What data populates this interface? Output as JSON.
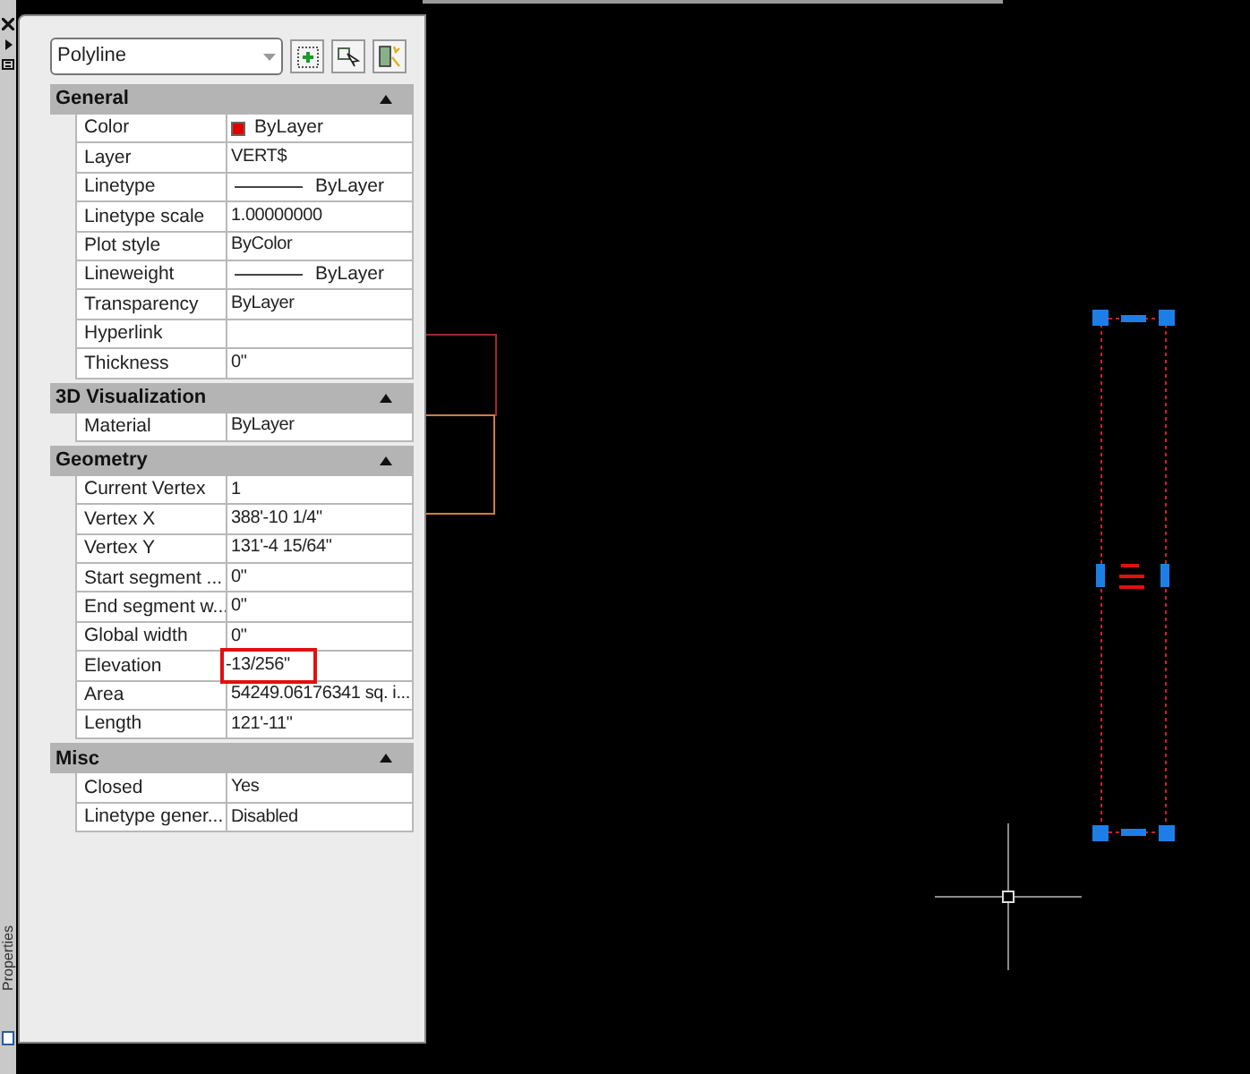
{
  "side_strip": {
    "label": "Properties"
  },
  "selector": {
    "value": "Polyline"
  },
  "sections": [
    {
      "title": "General",
      "expanded": true,
      "rows": [
        {
          "label": "Color",
          "value": "ByLayer",
          "kind": "swatch",
          "color": "#dd0000",
          "highlighted": false
        },
        {
          "label": "Layer",
          "value": "VERT$",
          "kind": "text",
          "highlighted": false
        },
        {
          "label": "Linetype",
          "value": "ByLayer",
          "kind": "line",
          "highlighted": false
        },
        {
          "label": "Linetype scale",
          "value": "1.00000000",
          "kind": "text",
          "highlighted": false
        },
        {
          "label": "Plot style",
          "value": "ByColor",
          "kind": "text",
          "highlighted": false
        },
        {
          "label": "Lineweight",
          "value": "ByLayer",
          "kind": "line",
          "highlighted": false
        },
        {
          "label": "Transparency",
          "value": "ByLayer",
          "kind": "text",
          "highlighted": false
        },
        {
          "label": "Hyperlink",
          "kind": "text",
          "highlighted": false
        },
        {
          "label": "Thickness",
          "value": "0\"",
          "kind": "text",
          "highlighted": false
        }
      ]
    },
    {
      "title": "3D Visualization",
      "expanded": true,
      "rows": [
        {
          "label": "Material",
          "value": "ByLayer",
          "kind": "text",
          "highlighted": false
        }
      ]
    },
    {
      "title": "Geometry",
      "expanded": true,
      "rows": [
        {
          "label": "Current Vertex",
          "value": "1",
          "kind": "text",
          "highlighted": false
        },
        {
          "label": "Vertex X",
          "value": "388'-10 1/4\"",
          "kind": "text",
          "highlighted": false
        },
        {
          "label": "Vertex Y",
          "value": "131'-4 15/64\"",
          "kind": "text",
          "highlighted": false
        },
        {
          "label": "Start segment ...",
          "value": "0\"",
          "kind": "text",
          "highlighted": false
        },
        {
          "label": "End segment w...",
          "value": "0\"",
          "kind": "text",
          "highlighted": false
        },
        {
          "label": "Global width",
          "value": "0\"",
          "kind": "text",
          "highlighted": false
        },
        {
          "label": "Elevation",
          "value": "-13/256\"",
          "kind": "text",
          "highlighted": true
        },
        {
          "label": "Area",
          "value": "54249.06176341 sq. i...",
          "kind": "text",
          "highlighted": false
        },
        {
          "label": "Length",
          "value": "121'-11\"",
          "kind": "text",
          "highlighted": false
        }
      ]
    },
    {
      "title": "Misc",
      "expanded": true,
      "rows": [
        {
          "label": "Closed",
          "value": "Yes",
          "kind": "text",
          "highlighted": false
        },
        {
          "label": "Linetype gener...",
          "value": "Disabled",
          "kind": "text",
          "highlighted": false
        }
      ]
    }
  ]
}
